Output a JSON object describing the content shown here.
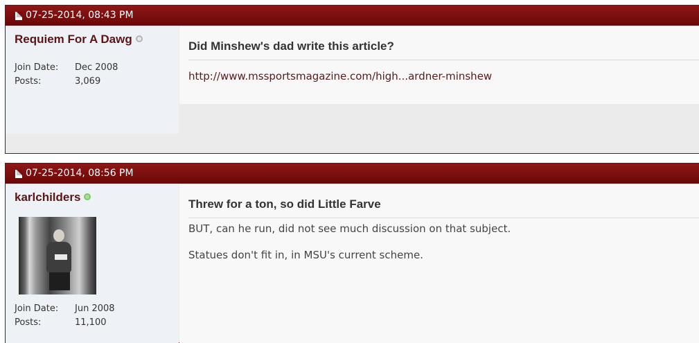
{
  "posts": [
    {
      "date": "07-25-2014, 08:43 PM",
      "username": "Requiem For A Dawg",
      "status": "offline",
      "join_label": "Join Date:",
      "join_value": "Dec 2008",
      "posts_label": "Posts:",
      "posts_value": "3,069",
      "title": "Did Minshew's dad write this article?",
      "link": "http://www.mssportsmagazine.com/high...ardner-minshew"
    },
    {
      "date": "07-25-2014, 08:56 PM",
      "username": "karlchilders",
      "status": "online",
      "join_label": "Join Date:",
      "join_value": "Jun 2008",
      "posts_label": "Posts:",
      "posts_value": "11,100",
      "title": "Threw for a ton, so did Little Farve",
      "body": [
        "BUT, can he run, did not see much discussion on that subject.",
        "Statues don't fit in, in MSU's current scheme."
      ]
    }
  ],
  "icons": {
    "post_icon": "document-icon",
    "offline": "offline-status-icon",
    "online": "online-status-icon"
  },
  "colors": {
    "header": "#7a0c0c",
    "username": "#5c1414",
    "online": "#7fc86a"
  }
}
